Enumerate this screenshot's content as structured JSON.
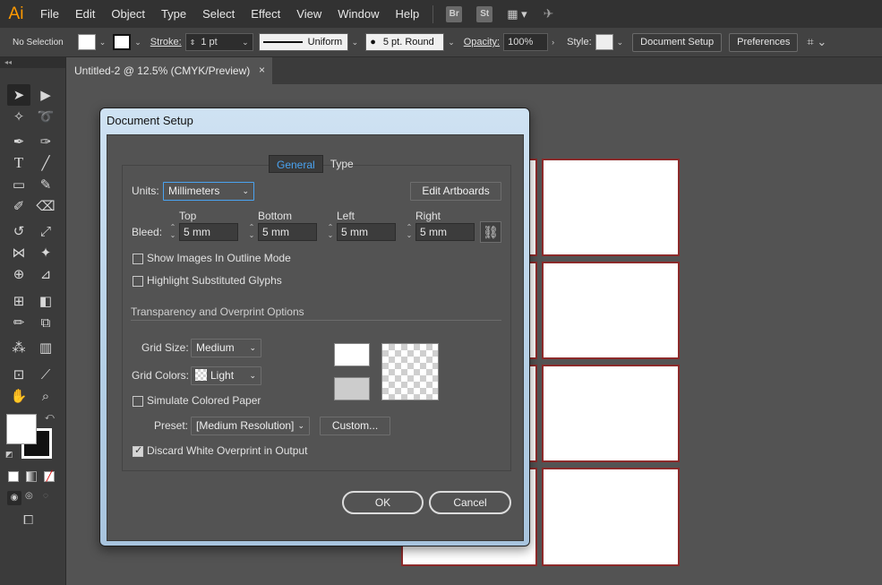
{
  "app": {
    "logo": "Ai"
  },
  "menu": [
    "File",
    "Edit",
    "Object",
    "Type",
    "Select",
    "Effect",
    "View",
    "Window",
    "Help"
  ],
  "app_badges": [
    "Br",
    "St"
  ],
  "control_bar": {
    "selection": "No Selection",
    "stroke_label": "Stroke:",
    "stroke_value": "1 pt",
    "profile": "Uniform",
    "brush": "5 pt. Round",
    "opacity_label": "Opacity:",
    "opacity_value": "100%",
    "style_label": "Style:",
    "document_setup": "Document Setup",
    "preferences": "Preferences"
  },
  "document_tab": {
    "title": "Untitled-2 @ 12.5% (CMYK/Preview)",
    "close": "×"
  },
  "dialog": {
    "title": "Document Setup",
    "tabs": [
      "General",
      "Type"
    ],
    "units_label": "Units:",
    "units_value": "Millimeters",
    "edit_artboards": "Edit Artboards",
    "bleed_label": "Bleed:",
    "bleed": {
      "top_label": "Top",
      "top": "5 mm",
      "bottom_label": "Bottom",
      "bottom": "5 mm",
      "left_label": "Left",
      "left": "5 mm",
      "right_label": "Right",
      "right": "5 mm"
    },
    "show_images_outline": {
      "label": "Show Images In Outline Mode",
      "checked": false
    },
    "highlight_glyphs": {
      "label": "Highlight Substituted Glyphs",
      "checked": false
    },
    "section_title": "Transparency and Overprint Options",
    "grid_size_label": "Grid Size:",
    "grid_size_value": "Medium",
    "grid_colors_label": "Grid Colors:",
    "grid_colors_value": "Light",
    "simulate_paper": {
      "label": "Simulate Colored Paper",
      "checked": false
    },
    "preset_label": "Preset:",
    "preset_value": "[Medium Resolution]",
    "custom_button": "Custom...",
    "discard_white": {
      "label": "Discard White Overprint in Output",
      "checked": true
    },
    "ok": "OK",
    "cancel": "Cancel"
  },
  "colors": {
    "accent": "#4aa3f0",
    "artboard_border": "#8c2a2a",
    "panel": "#535353"
  }
}
